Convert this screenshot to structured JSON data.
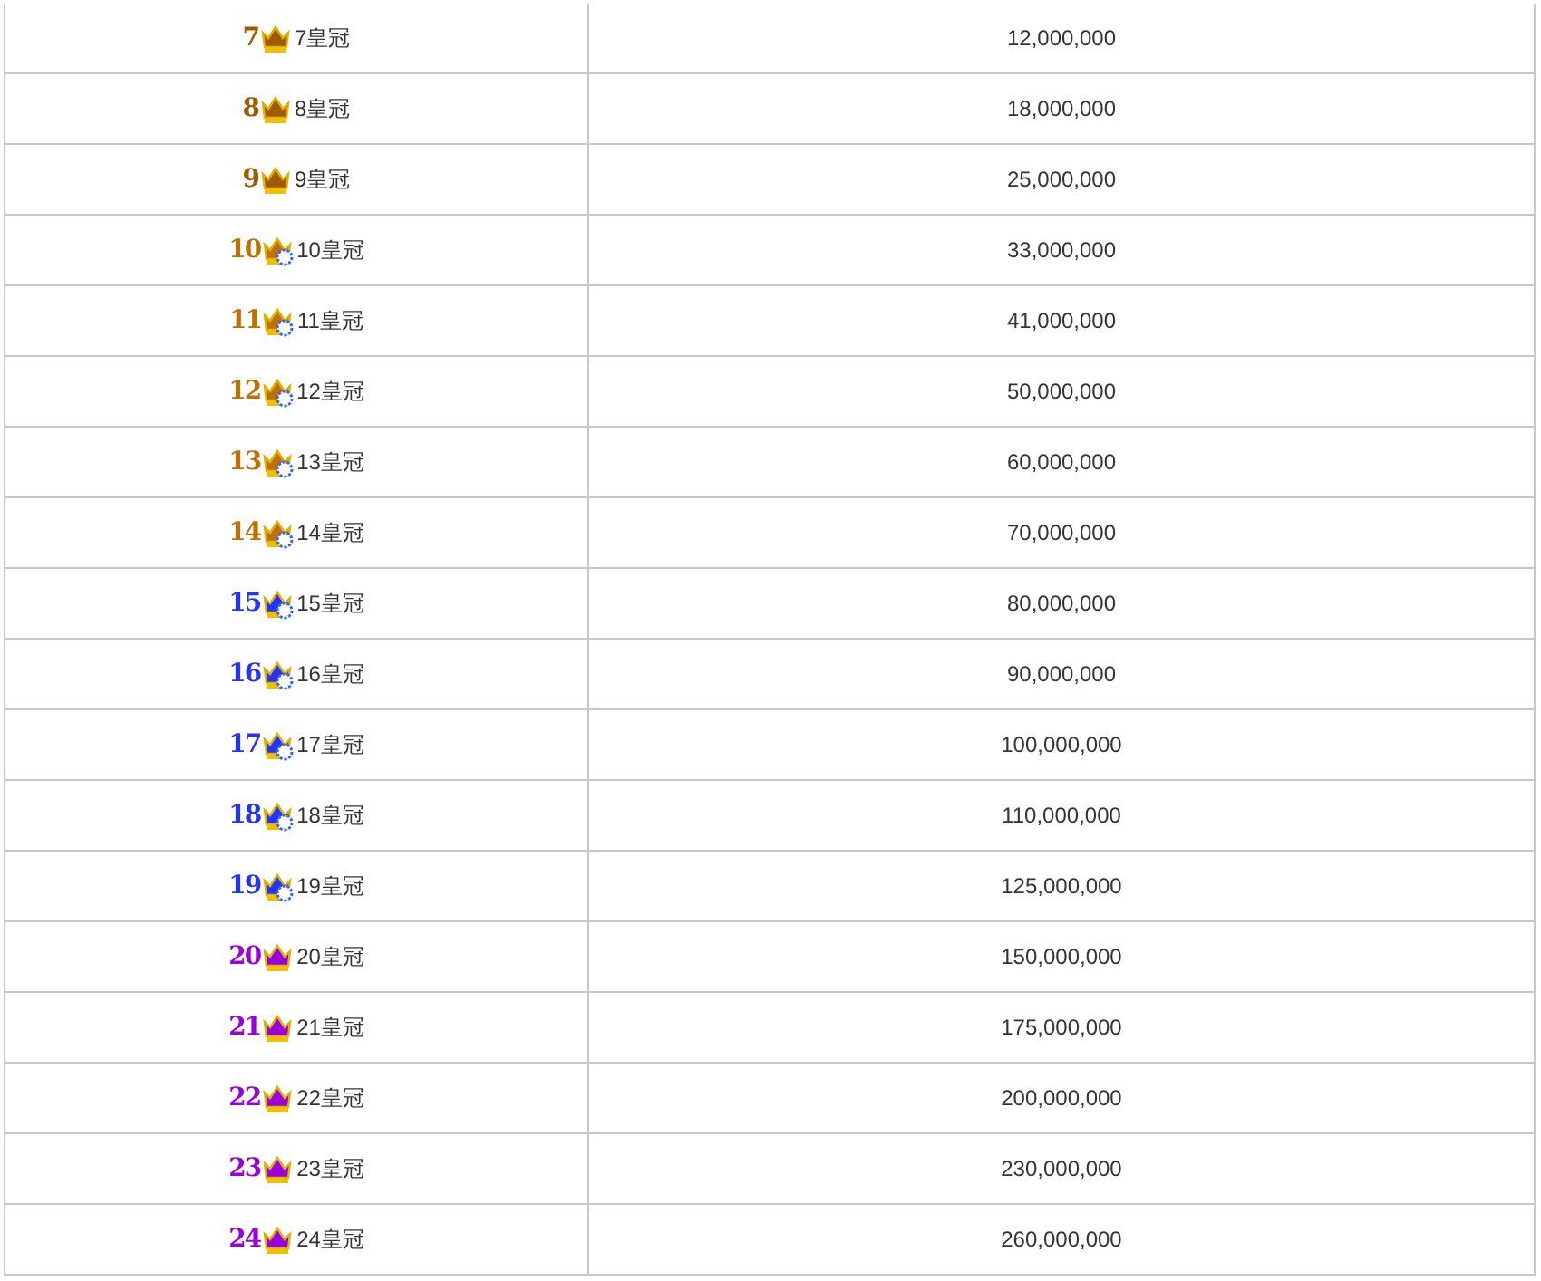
{
  "table": {
    "rows": [
      {
        "badge": "7",
        "color": "#a05a00",
        "gem": false,
        "level_name": "7皇冠",
        "amount": "12,000,000"
      },
      {
        "badge": "8",
        "color": "#a05a00",
        "gem": false,
        "level_name": "8皇冠",
        "amount": "18,000,000"
      },
      {
        "badge": "9",
        "color": "#a05a00",
        "gem": false,
        "level_name": "9皇冠",
        "amount": "25,000,000"
      },
      {
        "badge": "10",
        "color": "#c07000",
        "gem": true,
        "level_name": "10皇冠",
        "amount": "33,000,000"
      },
      {
        "badge": "11",
        "color": "#c07000",
        "gem": true,
        "level_name": "11皇冠",
        "amount": "41,000,000"
      },
      {
        "badge": "12",
        "color": "#c07000",
        "gem": true,
        "level_name": "12皇冠",
        "amount": "50,000,000"
      },
      {
        "badge": "13",
        "color": "#c07000",
        "gem": true,
        "level_name": "13皇冠",
        "amount": "60,000,000"
      },
      {
        "badge": "14",
        "color": "#c07000",
        "gem": true,
        "level_name": "14皇冠",
        "amount": "70,000,000"
      },
      {
        "badge": "15",
        "color": "#2233ff",
        "gem": true,
        "level_name": "15皇冠",
        "amount": "80,000,000"
      },
      {
        "badge": "16",
        "color": "#2233ff",
        "gem": true,
        "level_name": "16皇冠",
        "amount": "90,000,000"
      },
      {
        "badge": "17",
        "color": "#2233ff",
        "gem": true,
        "level_name": "17皇冠",
        "amount": "100,000,000"
      },
      {
        "badge": "18",
        "color": "#2233ff",
        "gem": true,
        "level_name": "18皇冠",
        "amount": "110,000,000"
      },
      {
        "badge": "19",
        "color": "#2233ff",
        "gem": true,
        "level_name": "19皇冠",
        "amount": "125,000,000"
      },
      {
        "badge": "20",
        "color": "#9900dd",
        "gem": false,
        "level_name": "20皇冠",
        "amount": "150,000,000"
      },
      {
        "badge": "21",
        "color": "#9900dd",
        "gem": false,
        "level_name": "21皇冠",
        "amount": "175,000,000"
      },
      {
        "badge": "22",
        "color": "#9900dd",
        "gem": false,
        "level_name": "22皇冠",
        "amount": "200,000,000"
      },
      {
        "badge": "23",
        "color": "#9900dd",
        "gem": false,
        "level_name": "23皇冠",
        "amount": "230,000,000"
      },
      {
        "badge": "24",
        "color": "#9900dd",
        "gem": false,
        "level_name": "24皇冠",
        "amount": "260,000,000"
      }
    ]
  }
}
